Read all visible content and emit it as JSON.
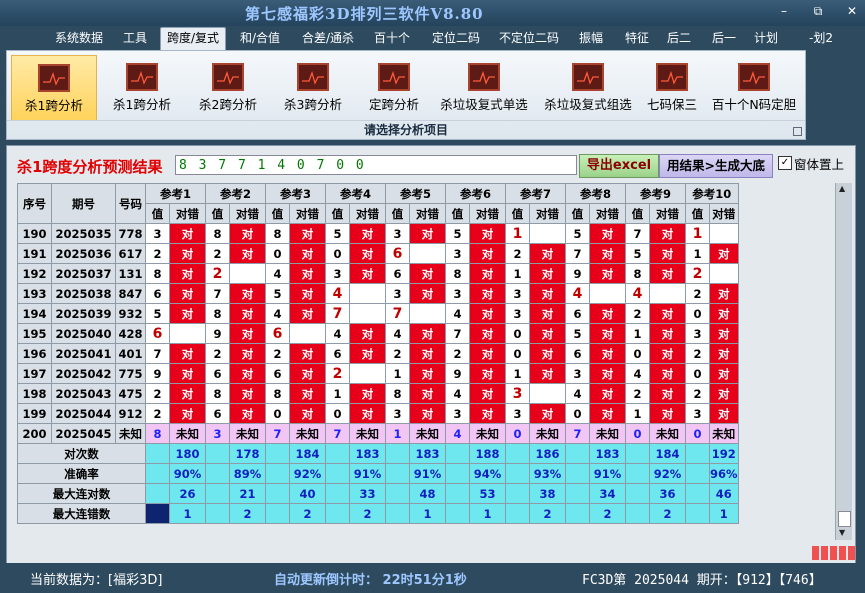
{
  "window": {
    "title": "第七感福彩3D排列三软件V8.80",
    "controls": [
      "–",
      "⧉",
      "✕"
    ]
  },
  "menu": [
    "系统数据",
    "工具",
    "跨度/复式",
    "和/合值",
    "合差/通杀",
    "百十个",
    "定位二码",
    "不定位二码",
    "振幅",
    "特征",
    "后二",
    "后一",
    "计划",
    "-划2"
  ],
  "menu_active_index": 2,
  "ribbon": {
    "buttons": [
      "杀1跨分析",
      "杀1跨分析",
      "杀2跨分析",
      "杀3跨分析",
      "定跨分析",
      "杀垃圾复式单选",
      "杀垃圾复式组选",
      "七码保三",
      "百十个N码定胆"
    ],
    "active_index": 0,
    "caption": "请选择分析项目"
  },
  "panel": {
    "label": "杀1跨度分析预测结果",
    "result": "8 3 7 7 1 4 0 7 0 0",
    "excel_button": "导出excel",
    "generate_button": "用结果>生成大底",
    "checkbox_label": "窗体置上",
    "checkbox_checked": true
  },
  "table": {
    "h_seq": "序号",
    "h_issue": "期号",
    "h_num": "号码",
    "ref_headers": [
      "参考1",
      "参考2",
      "参考3",
      "参考4",
      "参考5",
      "参考6",
      "参考7",
      "参考8",
      "参考9",
      "参考10"
    ],
    "sub_val": "值",
    "sub_cmp": "对错",
    "rows": [
      {
        "seq": "190",
        "issue": "2025035",
        "num": "778",
        "cells": [
          [
            "3",
            "对"
          ],
          [
            "8",
            "对"
          ],
          [
            "8",
            "对"
          ],
          [
            "5",
            "对"
          ],
          [
            "3",
            "对"
          ],
          [
            "5",
            "对"
          ],
          [
            "1",
            ""
          ],
          [
            "5",
            "对"
          ],
          [
            "7",
            "对"
          ],
          [
            "1",
            ""
          ]
        ]
      },
      {
        "seq": "191",
        "issue": "2025036",
        "num": "617",
        "cells": [
          [
            "2",
            "对"
          ],
          [
            "2",
            "对"
          ],
          [
            "0",
            "对"
          ],
          [
            "0",
            "对"
          ],
          [
            "6",
            ""
          ],
          [
            "3",
            "对"
          ],
          [
            "2",
            "对"
          ],
          [
            "7",
            "对"
          ],
          [
            "5",
            "对"
          ],
          [
            "1",
            "对"
          ]
        ]
      },
      {
        "seq": "192",
        "issue": "2025037",
        "num": "131",
        "cells": [
          [
            "8",
            "对"
          ],
          [
            "2",
            ""
          ],
          [
            "4",
            "对"
          ],
          [
            "3",
            "对"
          ],
          [
            "6",
            "对"
          ],
          [
            "8",
            "对"
          ],
          [
            "1",
            "对"
          ],
          [
            "9",
            "对"
          ],
          [
            "8",
            "对"
          ],
          [
            "2",
            ""
          ]
        ]
      },
      {
        "seq": "193",
        "issue": "2025038",
        "num": "847",
        "cells": [
          [
            "6",
            "对"
          ],
          [
            "7",
            "对"
          ],
          [
            "5",
            "对"
          ],
          [
            "4",
            ""
          ],
          [
            "3",
            "对"
          ],
          [
            "3",
            "对"
          ],
          [
            "3",
            "对"
          ],
          [
            "4",
            ""
          ],
          [
            "4",
            ""
          ],
          [
            "2",
            "对"
          ]
        ]
      },
      {
        "seq": "194",
        "issue": "2025039",
        "num": "932",
        "cells": [
          [
            "5",
            "对"
          ],
          [
            "8",
            "对"
          ],
          [
            "4",
            "对"
          ],
          [
            "7",
            ""
          ],
          [
            "7",
            ""
          ],
          [
            "4",
            "对"
          ],
          [
            "3",
            "对"
          ],
          [
            "6",
            "对"
          ],
          [
            "2",
            "对"
          ],
          [
            "0",
            "对"
          ]
        ]
      },
      {
        "seq": "195",
        "issue": "2025040",
        "num": "428",
        "cells": [
          [
            "6",
            ""
          ],
          [
            "9",
            "对"
          ],
          [
            "6",
            ""
          ],
          [
            "4",
            "对"
          ],
          [
            "4",
            "对"
          ],
          [
            "7",
            "对"
          ],
          [
            "0",
            "对"
          ],
          [
            "5",
            "对"
          ],
          [
            "1",
            "对"
          ],
          [
            "3",
            "对"
          ]
        ]
      },
      {
        "seq": "196",
        "issue": "2025041",
        "num": "401",
        "cells": [
          [
            "7",
            "对"
          ],
          [
            "2",
            "对"
          ],
          [
            "2",
            "对"
          ],
          [
            "6",
            "对"
          ],
          [
            "2",
            "对"
          ],
          [
            "2",
            "对"
          ],
          [
            "0",
            "对"
          ],
          [
            "6",
            "对"
          ],
          [
            "0",
            "对"
          ],
          [
            "2",
            "对"
          ]
        ]
      },
      {
        "seq": "197",
        "issue": "2025042",
        "num": "775",
        "cells": [
          [
            "9",
            "对"
          ],
          [
            "6",
            "对"
          ],
          [
            "6",
            "对"
          ],
          [
            "2",
            ""
          ],
          [
            "1",
            "对"
          ],
          [
            "9",
            "对"
          ],
          [
            "1",
            "对"
          ],
          [
            "3",
            "对"
          ],
          [
            "4",
            "对"
          ],
          [
            "0",
            "对"
          ]
        ]
      },
      {
        "seq": "198",
        "issue": "2025043",
        "num": "475",
        "cells": [
          [
            "2",
            "对"
          ],
          [
            "8",
            "对"
          ],
          [
            "8",
            "对"
          ],
          [
            "1",
            "对"
          ],
          [
            "8",
            "对"
          ],
          [
            "4",
            "对"
          ],
          [
            "3",
            ""
          ],
          [
            "4",
            "对"
          ],
          [
            "2",
            "对"
          ],
          [
            "2",
            "对"
          ]
        ]
      },
      {
        "seq": "199",
        "issue": "2025044",
        "num": "912",
        "cells": [
          [
            "2",
            "对"
          ],
          [
            "6",
            "对"
          ],
          [
            "0",
            "对"
          ],
          [
            "0",
            "对"
          ],
          [
            "3",
            "对"
          ],
          [
            "3",
            "对"
          ],
          [
            "3",
            "对"
          ],
          [
            "0",
            "对"
          ],
          [
            "1",
            "对"
          ],
          [
            "3",
            "对"
          ]
        ]
      }
    ],
    "unknown_row": {
      "seq": "200",
      "issue": "2025045",
      "num": "未知",
      "vals": [
        "8",
        "3",
        "7",
        "7",
        "1",
        "4",
        "0",
        "7",
        "0",
        "0"
      ],
      "cmp": "未知"
    },
    "stats": [
      {
        "label": "对次数",
        "values": [
          "180",
          "178",
          "184",
          "183",
          "183",
          "188",
          "186",
          "183",
          "184",
          "192"
        ]
      },
      {
        "label": "准确率",
        "values": [
          "90%",
          "89%",
          "92%",
          "91%",
          "91%",
          "94%",
          "93%",
          "91%",
          "92%",
          "96%"
        ]
      },
      {
        "label": "最大连对数",
        "values": [
          "26",
          "21",
          "40",
          "33",
          "48",
          "53",
          "38",
          "34",
          "36",
          "46"
        ]
      },
      {
        "label": "最大连错数",
        "values": [
          "1",
          "2",
          "2",
          "2",
          "1",
          "1",
          "2",
          "2",
          "2",
          "1"
        ]
      }
    ]
  },
  "status": {
    "current_data": "当前数据为：[福彩3D]",
    "countdown": "自动更新倒计时：  22时51分1秒",
    "issue": "FC3D第 2025044 期开：【912】【746】"
  }
}
